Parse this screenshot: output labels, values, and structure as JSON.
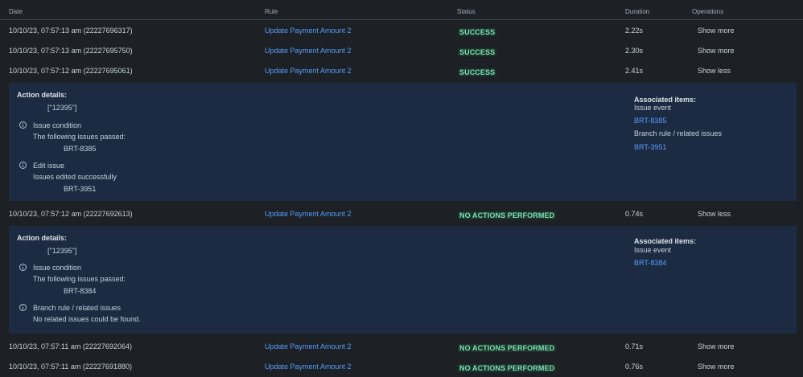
{
  "columns": {
    "date": "Date",
    "rule": "Rule",
    "status": "Status",
    "duration": "Duration",
    "operations": "Operations"
  },
  "colors": {
    "background": "#1d2125",
    "panel": "#1c2b41",
    "link": "#579dff",
    "lozenge_bg": "#1c3329",
    "lozenge_text": "#7ee2b8"
  },
  "rows": [
    {
      "date": "10/10/23, 07:57:13 am (22227696317)",
      "rule": "Update Payment Amount 2",
      "status": "SUCCESS",
      "duration": "2.22s",
      "operation": "Show more"
    },
    {
      "date": "10/10/23, 07:57:13 am (22227695750)",
      "rule": "Update Payment Amount 2",
      "status": "SUCCESS",
      "duration": "2.30s",
      "operation": "Show more"
    },
    {
      "date": "10/10/23, 07:57:12 am (22227695061)",
      "rule": "Update Payment Amount 2",
      "status": "SUCCESS",
      "duration": "2.41s",
      "operation": "Show less"
    },
    {
      "date": "10/10/23, 07:57:12 am (22227692613)",
      "rule": "Update Payment Amount 2",
      "status": "NO ACTIONS PERFORMED",
      "duration": "0.74s",
      "operation": "Show less"
    },
    {
      "date": "10/10/23, 07:57:11 am (22227692064)",
      "rule": "Update Payment Amount 2",
      "status": "NO ACTIONS PERFORMED",
      "duration": "0.71s",
      "operation": "Show more"
    },
    {
      "date": "10/10/23, 07:57:11 am (22227691880)",
      "rule": "Update Payment Amount 2",
      "status": "NO ACTIONS PERFORMED",
      "duration": "0.76s",
      "operation": "Show more"
    }
  ],
  "panel1": {
    "action_details_label": "Action details:",
    "action_value": "[\"12395\"]",
    "step1_title": "Issue condition",
    "step1_sub": "The following issues passed:",
    "step1_item": "BRT-8385",
    "step2_title": "Edit issue",
    "step2_sub": "Issues edited successfully",
    "step2_item": "BRT-3951",
    "associated_label": "Associated items:",
    "assoc_group1": "Issue event",
    "assoc_link1": "BRT-8385",
    "assoc_group2": "Branch rule / related issues",
    "assoc_link2": "BRT-3951"
  },
  "panel2": {
    "action_details_label": "Action details:",
    "action_value": "[\"12395\"]",
    "step1_title": "Issue condition",
    "step1_sub": "The following issues passed:",
    "step1_item": "BRT-8384",
    "step2_title": "Branch rule / related issues",
    "step2_sub": "No related issues could be found.",
    "associated_label": "Associated items:",
    "assoc_group1": "Issue event",
    "assoc_link1": "BRT-8384"
  }
}
